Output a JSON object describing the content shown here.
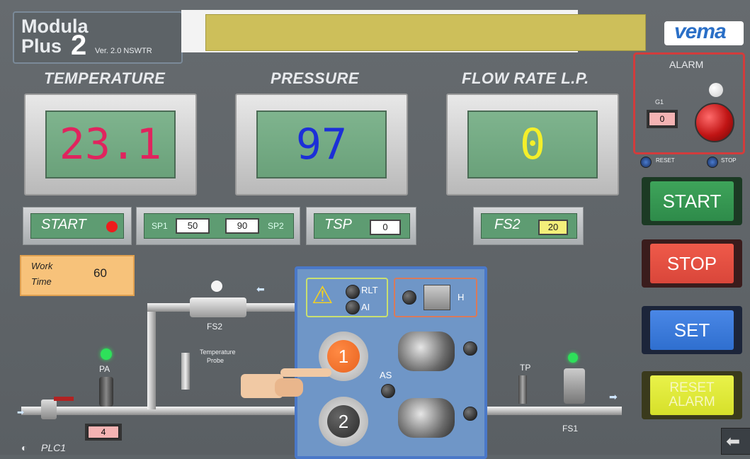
{
  "header": {
    "app_name_line1": "Modula",
    "app_name_line2": "Plus",
    "app_version_num": "2",
    "version": "Ver. 2.0 NSWTR",
    "brand": "vema"
  },
  "meters": {
    "temperature": {
      "label": "TEMPERATURE",
      "value": "23.1",
      "color": "#e0245e"
    },
    "pressure": {
      "label": "PRESSURE",
      "value": "97",
      "color": "#1c2fd8"
    },
    "flow": {
      "label": "FLOW RATE L.P.",
      "value": "0",
      "color": "#f4ef2a"
    }
  },
  "controls": {
    "start_label": "START",
    "sp1_label": "SP1",
    "sp1_value": "50",
    "sp2_value": "90",
    "sp2_label": "SP2",
    "tsp_label": "TSP",
    "tsp_value": "0",
    "fs2_label": "FS2",
    "fs2_value": "20"
  },
  "work_time": {
    "label_line1": "Work",
    "label_line2": "Time",
    "value": "60"
  },
  "alarm": {
    "title": "ALARM",
    "g1_label": "G1",
    "g1_value": "0",
    "reset_label": "RESET",
    "stop_label": "STOP"
  },
  "buttons": {
    "start": "START",
    "stop": "STOP",
    "set": "SET",
    "reset_alarm_line1": "RESET",
    "reset_alarm_line2": "ALARM"
  },
  "schematic": {
    "rlt": "RLT",
    "ai": "AI",
    "h": "H",
    "as": "AS",
    "pump1": "1",
    "pump2": "2",
    "fs2": "FS2",
    "temp_probe_line1": "Temperature",
    "temp_probe_line2": "Probe",
    "pa": "PA",
    "pa_value": "4",
    "tp": "TP",
    "fs1": "FS1",
    "plc": "PLC1"
  },
  "colors": {
    "start_button": "#2e8b4a",
    "stop_button": "#d9463a",
    "set_button": "#2f6fcf",
    "reset_alarm_button": "#d6e02a",
    "pump1_active": "#e8631f",
    "alarm_border": "#d23c3c"
  }
}
